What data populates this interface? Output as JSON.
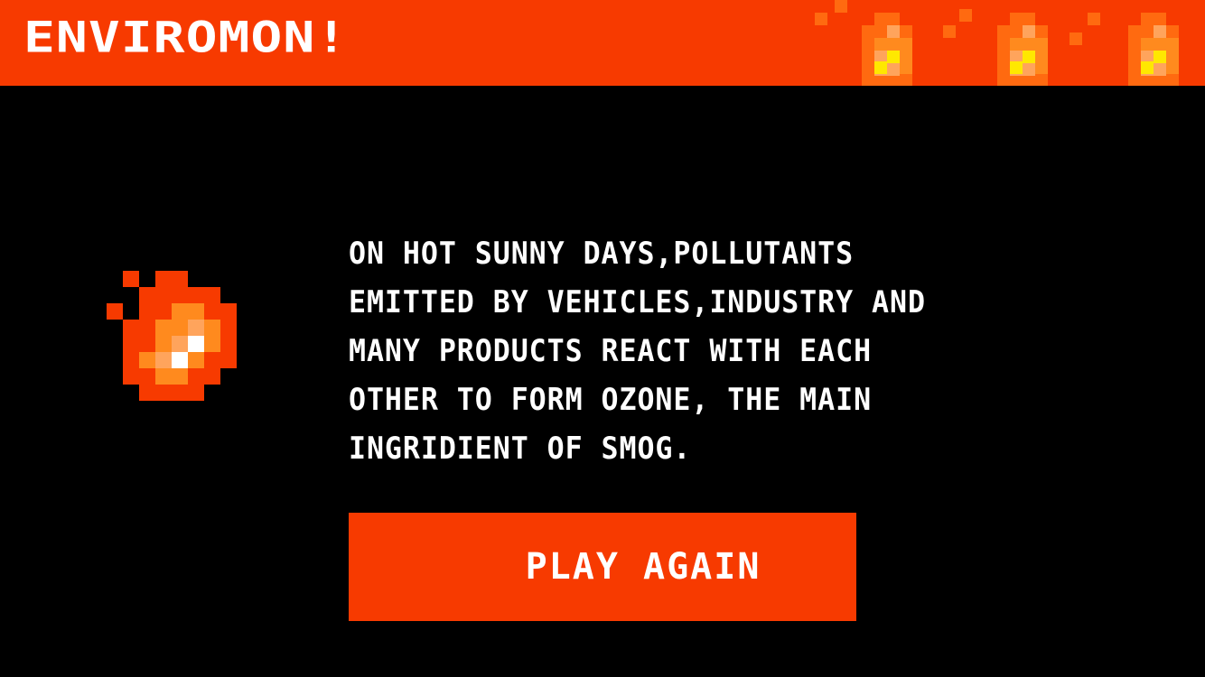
{
  "app": {
    "title": "ENVIROMON!"
  },
  "colors": {
    "accent": "#F73A00",
    "background": "#000000",
    "text": "#FFFFFF",
    "flame_orange": "#FF8A1E",
    "flame_light": "#FFA45C",
    "flame_yellow": "#FFE800"
  },
  "icons": {
    "header_decoration": "pixel-flame-icon",
    "main_icon": "pixel-fireball-icon"
  },
  "message": {
    "text": "ON HOT SUNNY DAYS,POLLUTANTS\nEMITTED BY VEHICLES,INDUSTRY AND\nMANY PRODUCTS REACT WITH EACH\nOTHER TO FORM OZONE, THE MAIN\nINGRIDIENT OF SMOG."
  },
  "actions": {
    "play_again_label": "PLAY AGAIN"
  }
}
